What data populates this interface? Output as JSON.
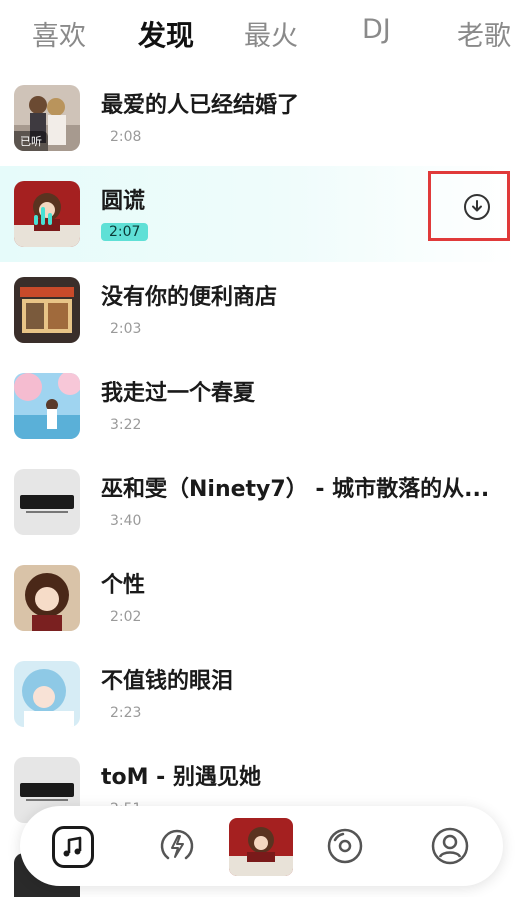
{
  "tabs": [
    {
      "label": "喜欢",
      "active": false
    },
    {
      "label": "发现",
      "active": true
    },
    {
      "label": "最火",
      "active": false
    },
    {
      "label": "DJ",
      "active": false
    },
    {
      "label": "老歌",
      "active": false
    }
  ],
  "songs": [
    {
      "title": "最爱的人已经结婚了",
      "duration": "2:08",
      "tag": "已听",
      "cover_icon": "couple-artwork"
    },
    {
      "title": "圆谎",
      "duration": "2:07",
      "playing": true,
      "cover_icon": "anime-girl-red-artwork"
    },
    {
      "title": "没有你的便利商店",
      "duration": "2:03",
      "cover_icon": "convenience-store-artwork"
    },
    {
      "title": "我走过一个春夏",
      "duration": "3:22",
      "cover_icon": "cherry-blossom-artwork"
    },
    {
      "title": "巫和雯（Ninety7） - 城市散落的从...",
      "duration": "3:40",
      "cover_icon": "music-brand-logo-artwork"
    },
    {
      "title": "个性",
      "duration": "2:02",
      "cover_icon": "anime-girl-portrait-artwork"
    },
    {
      "title": "不值钱的眼泪",
      "duration": "2:23",
      "cover_icon": "blue-hair-girl-artwork"
    },
    {
      "title": "toM - 别遇见她",
      "duration": "2:51",
      "cover_icon": "music-brand-logo-artwork"
    }
  ],
  "actions": {
    "download_icon": "download-icon"
  },
  "bottom_nav": {
    "items": [
      "music-note-icon",
      "lightning-icon",
      "now-playing-cover",
      "disc-icon",
      "user-profile-icon"
    ]
  },
  "colors": {
    "accent": "#4fd9d0",
    "highlight_box": "#e03a3a",
    "text_primary": "#1a1a1a",
    "text_secondary": "#9a9a9a"
  }
}
